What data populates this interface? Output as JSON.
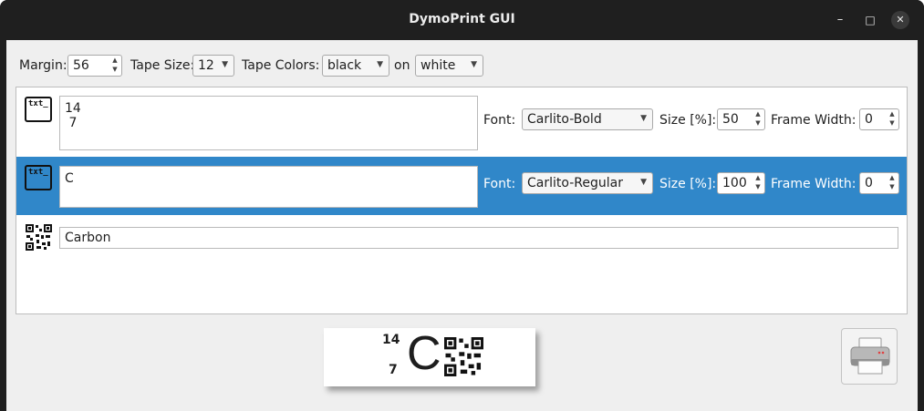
{
  "window": {
    "title": "DymoPrint GUI",
    "minimize": "–",
    "maximize": "□",
    "close": "✕"
  },
  "toolbar": {
    "margin_label": "Margin:",
    "margin_value": "56",
    "tape_size_label": "Tape Size:",
    "tape_size_value": "12",
    "tape_colors_label": "Tape Colors:",
    "tape_color_value": "black",
    "on_label": "on",
    "background_color_value": "white"
  },
  "rows": [
    {
      "text": "14\n 7",
      "font_label": "Font:",
      "font_value": "Carlito-Bold",
      "size_label": "Size [%]:",
      "size_value": "50",
      "frame_label": "Frame Width:",
      "frame_value": "0",
      "icon": "txt_"
    },
    {
      "text": "C",
      "font_label": "Font:",
      "font_value": "Carlito-Regular",
      "size_label": "Size [%]:",
      "size_value": "100",
      "frame_label": "Frame Width:",
      "frame_value": "0",
      "icon": "txt_"
    },
    {
      "text": "Carbon",
      "icon": "qr-code-icon"
    }
  ],
  "preview": {
    "line1": "14",
    "line2": "7",
    "big": "C"
  },
  "colors": {
    "selection": "#3087c9",
    "titlebar": "#1f1f1f",
    "window_bg": "#efefef"
  }
}
